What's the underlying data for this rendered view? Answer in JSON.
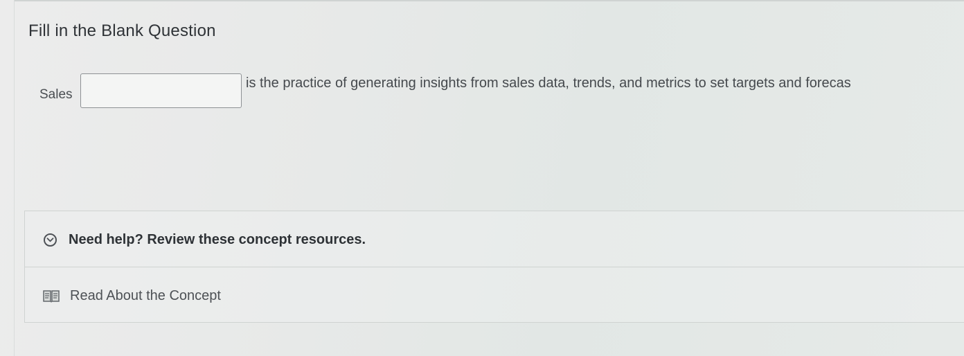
{
  "question": {
    "title": "Fill in the Blank Question",
    "prefix": "Sales",
    "blank_value": "",
    "suffix": "is the practice of generating insights from sales data, trends, and metrics to set targets and forecas"
  },
  "help": {
    "header_label": "Need help? Review these concept resources.",
    "header_icon": "chevron-down-circle-icon",
    "resources": [
      {
        "label": "Read About the Concept",
        "icon": "book-icon"
      }
    ]
  },
  "colors": {
    "text": "#2f3337",
    "border": "#cfd3d1",
    "input_border": "#8d9194"
  }
}
